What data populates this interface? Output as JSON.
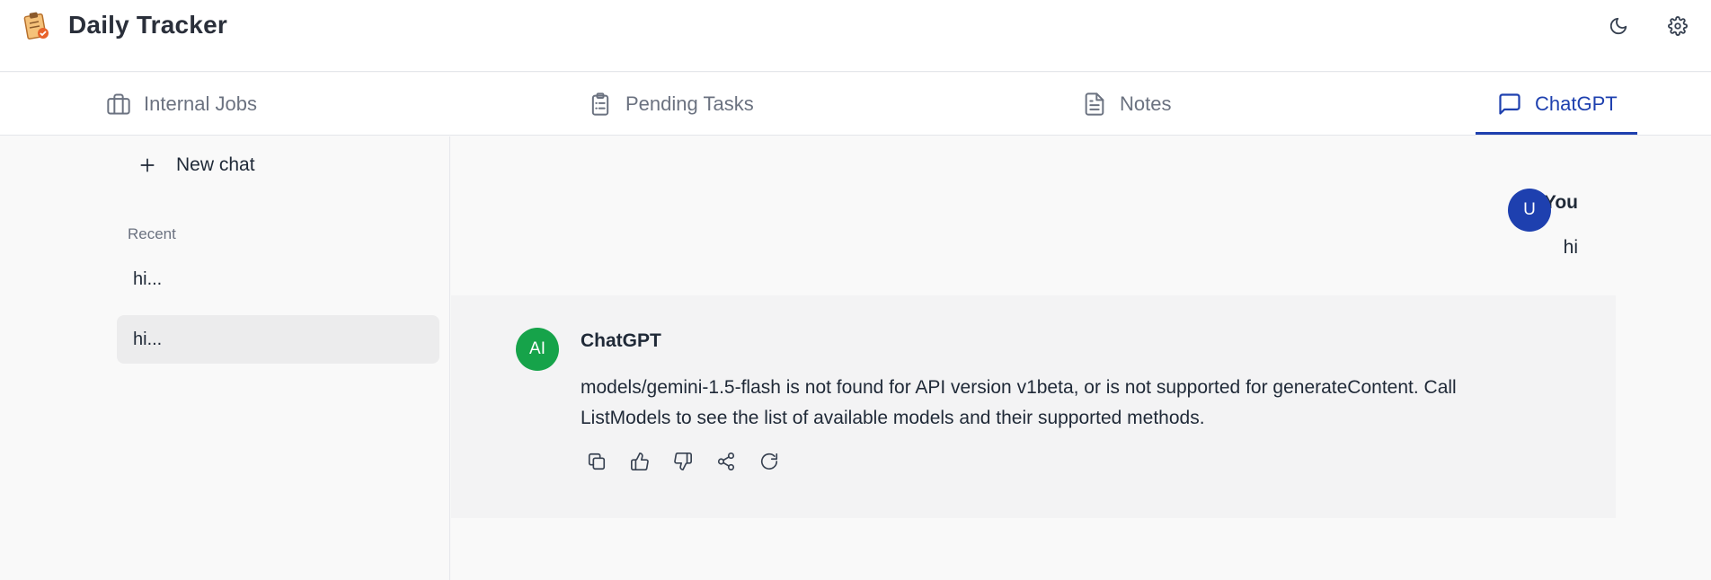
{
  "app": {
    "title": "Daily Tracker"
  },
  "tabs": [
    {
      "label": "Internal Jobs",
      "icon": "briefcase-icon"
    },
    {
      "label": "Pending Tasks",
      "icon": "clipboard-icon"
    },
    {
      "label": "Notes",
      "icon": "document-icon"
    },
    {
      "label": "ChatGPT",
      "icon": "chat-bubble-icon",
      "active": true
    }
  ],
  "sidebar": {
    "new_chat_label": "New chat",
    "recent_label": "Recent",
    "items": [
      {
        "label": "hi..."
      },
      {
        "label": "hi...",
        "selected": true
      }
    ]
  },
  "chat": {
    "user": {
      "name": "You",
      "avatar": "U",
      "message": "hi"
    },
    "ai": {
      "name": "ChatGPT",
      "avatar": "AI",
      "message": "models/gemini-1.5-flash is not found for API version v1beta, or is not supported for generateContent. Call ListModels to see the list of available models and their supported methods."
    },
    "actions": [
      "copy-icon",
      "thumbs-up-icon",
      "thumbs-down-icon",
      "share-icon",
      "regenerate-icon"
    ]
  },
  "colors": {
    "accent": "#1e40af",
    "ai_avatar": "#16a34a",
    "user_avatar": "#1e40af"
  }
}
